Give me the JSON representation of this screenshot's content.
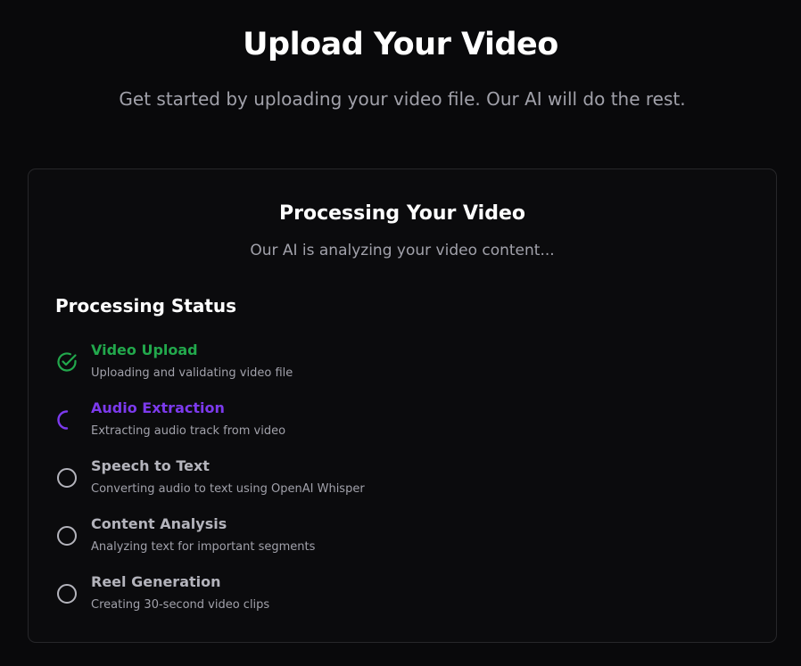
{
  "header": {
    "title": "Upload Your Video",
    "subtitle": "Get started by uploading your video file. Our AI will do the rest."
  },
  "card": {
    "title": "Processing Your Video",
    "subtitle": "Our AI is analyzing your video content...",
    "status_heading": "Processing Status"
  },
  "colors": {
    "done": "#22a84c",
    "active": "#7c3aed",
    "pending": "#b4b4bc"
  },
  "steps": [
    {
      "title": "Video Upload",
      "description": "Uploading and validating video file",
      "state": "done",
      "icon": "check-circle-icon"
    },
    {
      "title": "Audio Extraction",
      "description": "Extracting audio track from video",
      "state": "active",
      "icon": "spinner-icon"
    },
    {
      "title": "Speech to Text",
      "description": "Converting audio to text using OpenAI Whisper",
      "state": "pending",
      "icon": "empty-circle-icon"
    },
    {
      "title": "Content Analysis",
      "description": "Analyzing text for important segments",
      "state": "pending",
      "icon": "empty-circle-icon"
    },
    {
      "title": "Reel Generation",
      "description": "Creating 30-second video clips",
      "state": "pending",
      "icon": "empty-circle-icon"
    }
  ]
}
